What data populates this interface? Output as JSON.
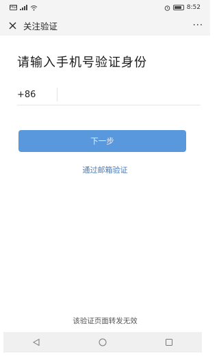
{
  "status_bar": {
    "sim_text": "HD",
    "signal_text": "⁴⁶ᵢₗ",
    "wifi_icon": "wifi-icon",
    "alarm_icon": "alarm-icon",
    "time": "8:52"
  },
  "header": {
    "close_icon": "close-icon",
    "title": "关注验证",
    "more_label": "···"
  },
  "main": {
    "heading": "请输入手机号验证身份",
    "country_code": "+86",
    "phone_value": "",
    "phone_placeholder": "",
    "next_button": "下一步",
    "email_link": "通过邮箱验证"
  },
  "footer": {
    "note": "该验证页面转发无效"
  },
  "nav_bar": {
    "back_icon": "back-triangle-icon",
    "home_icon": "home-circle-icon",
    "recents_icon": "recents-square-icon"
  },
  "colors": {
    "accent": "#5a98de",
    "link": "#4a79b5",
    "bar_background": "#f4f4f4"
  }
}
